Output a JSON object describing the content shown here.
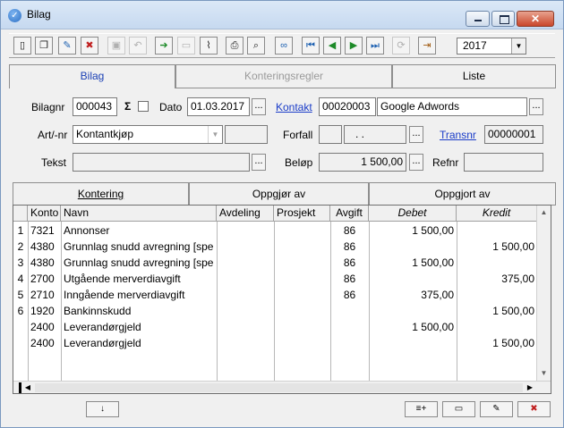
{
  "window": {
    "title": "Bilag",
    "icon": "checkmark-circle-icon"
  },
  "toolbar": {
    "buttons": [
      {
        "icon": "new-document-icon",
        "glyph": "▯"
      },
      {
        "icon": "copy-document-icon",
        "glyph": "❐"
      },
      {
        "icon": "edit-record-icon",
        "glyph": "✎"
      },
      {
        "icon": "delete-record-icon",
        "glyph": "✖"
      },
      {
        "icon": "save-icon",
        "glyph": "▣"
      },
      {
        "icon": "undo-icon",
        "glyph": "↶"
      },
      {
        "icon": "export-icon",
        "glyph": "➔"
      },
      {
        "icon": "open-folder-icon",
        "glyph": "▭"
      },
      {
        "icon": "attachment-icon",
        "glyph": "⌇"
      },
      {
        "icon": "print-icon",
        "glyph": "⎙"
      },
      {
        "icon": "print-preview-icon",
        "glyph": "⌕"
      },
      {
        "icon": "search-binoculars-icon",
        "glyph": "∞"
      },
      {
        "icon": "first-record-icon",
        "glyph": "⏮"
      },
      {
        "icon": "previous-record-icon",
        "glyph": "◀"
      },
      {
        "icon": "next-record-icon",
        "glyph": "▶"
      },
      {
        "icon": "last-record-icon",
        "glyph": "⏭"
      },
      {
        "icon": "refresh-icon",
        "glyph": "⟳"
      },
      {
        "icon": "exit-door-icon",
        "glyph": "⇥"
      }
    ],
    "year": "2017"
  },
  "top_tabs": [
    {
      "label": "Bilag"
    },
    {
      "label": "Konteringsregler"
    },
    {
      "label": "Liste"
    }
  ],
  "form": {
    "bilagnr_label": "Bilagnr",
    "bilagnr_value": "000043",
    "sigma_label": "Σ",
    "dato_label": "Dato",
    "dato_value": "01.03.2017",
    "kontakt_label": "Kontakt",
    "kontakt_id": "00020003",
    "kontakt_name": "Google Adwords",
    "artnr_label": "Art/-nr",
    "artnr_value": "Kontantkjøp",
    "forfall_label": "Forfall",
    "forfall_value": ". .",
    "transnr_label": "Transnr",
    "transnr_value": "00000001",
    "tekst_label": "Tekst",
    "tekst_value": "",
    "belop_label": "Beløp",
    "belop_value": "1 500,00",
    "refnr_label": "Refnr",
    "refnr_value": "",
    "ellipsis": "..."
  },
  "bottom_tabs": [
    {
      "label": "Kontering"
    },
    {
      "label": "Oppgjør av"
    },
    {
      "label": "Oppgjort av"
    }
  ],
  "grid": {
    "headers": {
      "konto": "Konto",
      "navn": "Navn",
      "avdeling": "Avdeling",
      "prosjekt": "Prosjekt",
      "avgift": "Avgift",
      "debet": "Debet",
      "kredit": "Kredit"
    },
    "rows": [
      {
        "nr": "1",
        "konto": "7321",
        "navn": "Annonser",
        "avgift": "86",
        "debet": "1 500,00",
        "kredit": ""
      },
      {
        "nr": "2",
        "konto": "4380",
        "navn": "Grunnlag snudd avregning [spe",
        "avgift": "86",
        "debet": "",
        "kredit": "1 500,00"
      },
      {
        "nr": "3",
        "konto": "4380",
        "navn": "Grunnlag snudd avregning [spe",
        "avgift": "86",
        "debet": "1 500,00",
        "kredit": ""
      },
      {
        "nr": "4",
        "konto": "2700",
        "navn": "Utgående merverdiavgift",
        "avgift": "86",
        "debet": "",
        "kredit": "375,00"
      },
      {
        "nr": "5",
        "konto": "2710",
        "navn": "Inngående merverdiavgift",
        "avgift": "86",
        "debet": "375,00",
        "kredit": ""
      },
      {
        "nr": "6",
        "konto": "1920",
        "navn": "Bankinnskudd",
        "avgift": "",
        "debet": "",
        "kredit": "1 500,00"
      },
      {
        "nr": "",
        "konto": "2400",
        "navn": "Leverandørgjeld",
        "avgift": "",
        "debet": "1 500,00",
        "kredit": ""
      },
      {
        "nr": "",
        "konto": "2400",
        "navn": "Leverandørgjeld",
        "avgift": "",
        "debet": "",
        "kredit": "1 500,00"
      }
    ]
  },
  "status_buttons": [
    {
      "icon": "arrow-down-icon",
      "glyph": "↓"
    },
    {
      "icon": "add-line-icon",
      "glyph": "≡+"
    },
    {
      "icon": "insert-line-icon",
      "glyph": "▭"
    },
    {
      "icon": "edit-line-icon",
      "glyph": "✎"
    },
    {
      "icon": "delete-line-icon",
      "glyph": "✖"
    }
  ]
}
